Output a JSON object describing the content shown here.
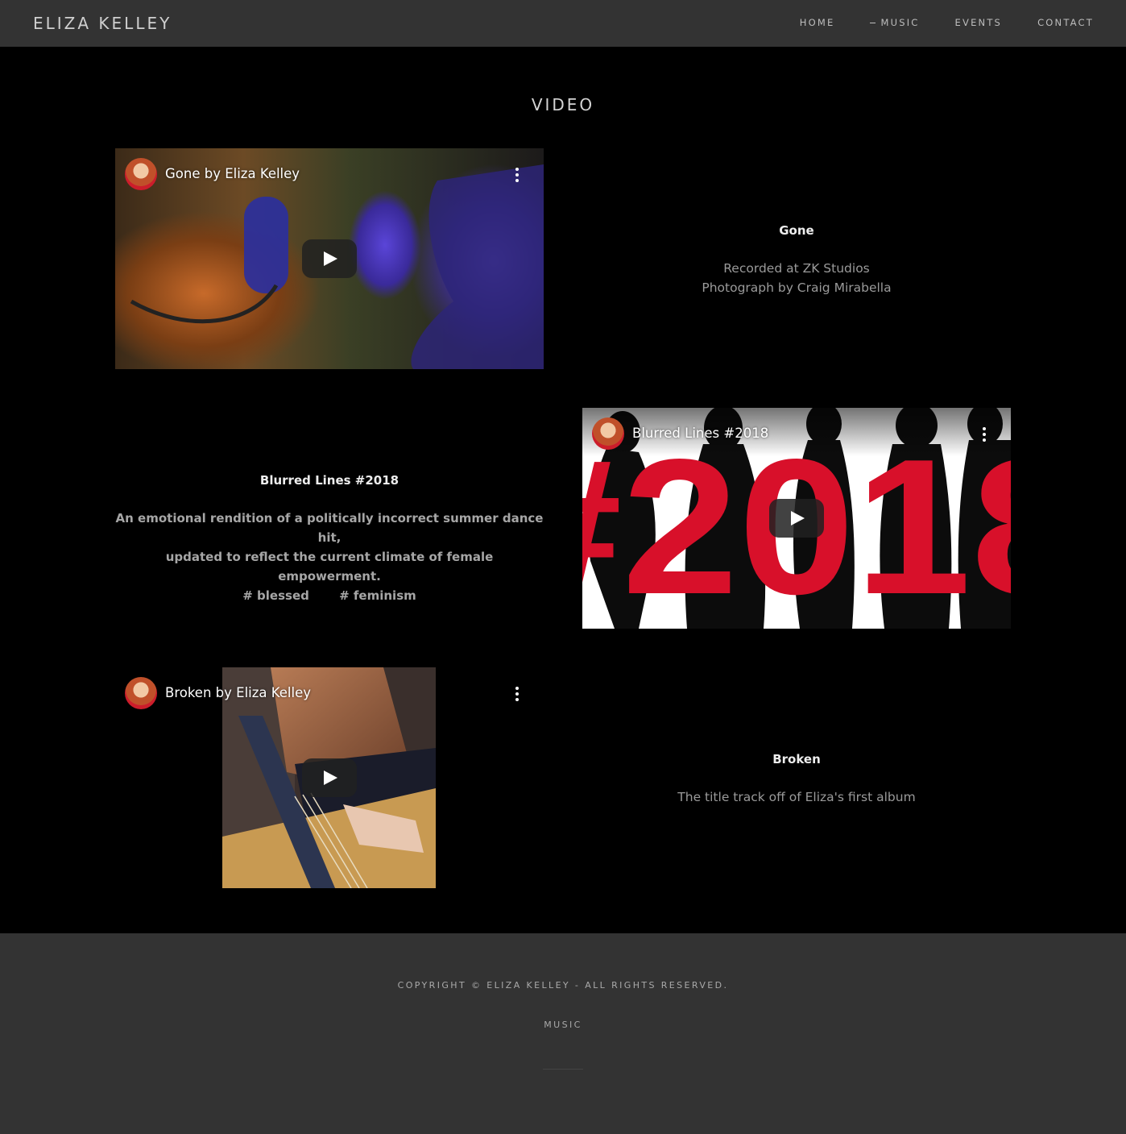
{
  "header": {
    "brand": "ELIZA KELLEY",
    "nav": [
      {
        "label": "HOME"
      },
      {
        "label": "MUSIC"
      },
      {
        "label": "EVENTS"
      },
      {
        "label": "CONTACT"
      }
    ]
  },
  "main": {
    "title": "VIDEO",
    "videos": [
      {
        "player_title": "Gone by Eliza Kelley",
        "heading": "Gone",
        "lines": [
          "Recorded at ZK Studios",
          "Photograph by Craig Mirabella"
        ]
      },
      {
        "player_title": "Blurred Lines #2018",
        "heading": "Blurred Lines #2018",
        "lines": [
          "An emotional rendition of a politically incorrect summer dance hit,",
          "updated to reflect the current climate of female empowerment."
        ],
        "tags": [
          "# blessed",
          "# feminism"
        ],
        "thumbnail_text": "#2018"
      },
      {
        "player_title": "Broken by Eliza Kelley",
        "heading": "Broken",
        "lines": [
          "The title track off of Eliza's first album"
        ]
      }
    ]
  },
  "footer": {
    "copyright": "COPYRIGHT © ELIZA KELLEY - ALL RIGHTS RESERVED.",
    "link": "MUSIC"
  },
  "colors": {
    "header_bg": "#333333",
    "page_bg": "#000000",
    "footer_bg": "#333333",
    "accent_red": "#d8102a"
  }
}
